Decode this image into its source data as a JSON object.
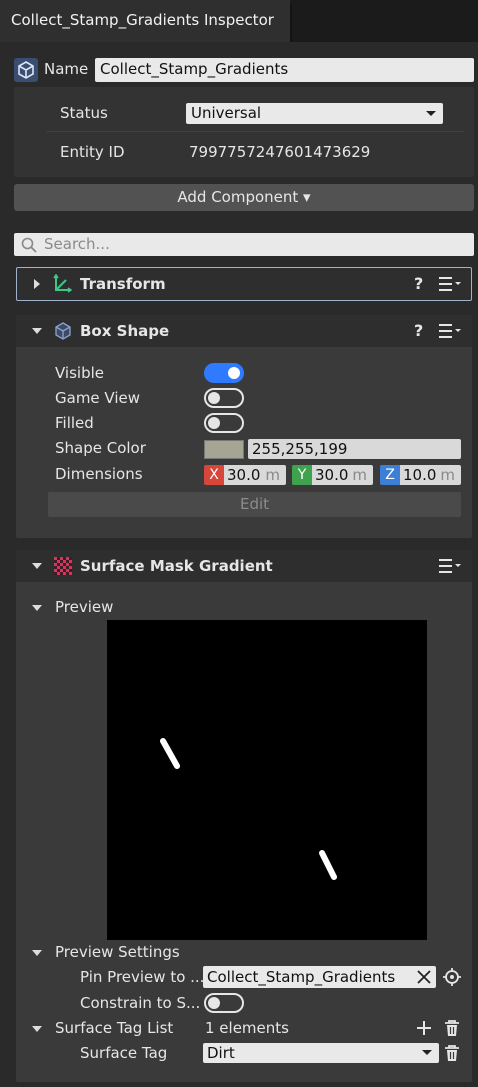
{
  "tab": {
    "title": "Collect_Stamp_Gradients Inspector"
  },
  "entity": {
    "name_label": "Name",
    "name_value": "Collect_Stamp_Gradients",
    "status_label": "Status",
    "status_value": "Universal",
    "entity_id_label": "Entity ID",
    "entity_id_value": "7997757247601473629"
  },
  "add_component": {
    "label": "Add Component ▾"
  },
  "search": {
    "placeholder": "Search..."
  },
  "transform": {
    "title": "Transform",
    "help": "?"
  },
  "box_shape": {
    "title": "Box Shape",
    "help": "?",
    "visible_label": "Visible",
    "visible": true,
    "game_view_label": "Game View",
    "game_view": false,
    "filled_label": "Filled",
    "filled": false,
    "shape_color_label": "Shape Color",
    "shape_color_value": "255,255,199",
    "shape_color_hex": "#a6a593",
    "dimensions_label": "Dimensions",
    "x_axis": "X",
    "x_value": "30.0",
    "y_axis": "Y",
    "y_value": "30.0",
    "z_axis": "Z",
    "z_value": "10.0",
    "unit": "m",
    "edit_label": "Edit"
  },
  "surface_mask": {
    "title": "Surface Mask Gradient",
    "preview_label": "Preview",
    "preview_settings_label": "Preview Settings",
    "pin_preview_label": "Pin Preview to ...",
    "pin_preview_value": "Collect_Stamp_Gradients",
    "constrain_label": "Constrain to S...",
    "constrain": false,
    "tag_list_label": "Surface Tag List",
    "tag_list_count": "1 elements",
    "surface_tag_label": "Surface Tag",
    "surface_tag_value": "Dirt"
  },
  "colors": {
    "accent": "#2e7bff",
    "axis_x": "#d6463a",
    "axis_y": "#3fa34d",
    "axis_z": "#3d7fd6",
    "transform_icon": "#3ec78a"
  },
  "icons": {
    "entity": "entity-cube-icon",
    "transform": "transform-axes-icon",
    "box_shape": "box-shape-icon",
    "surface_mask": "surface-mask-gradient-icon"
  }
}
